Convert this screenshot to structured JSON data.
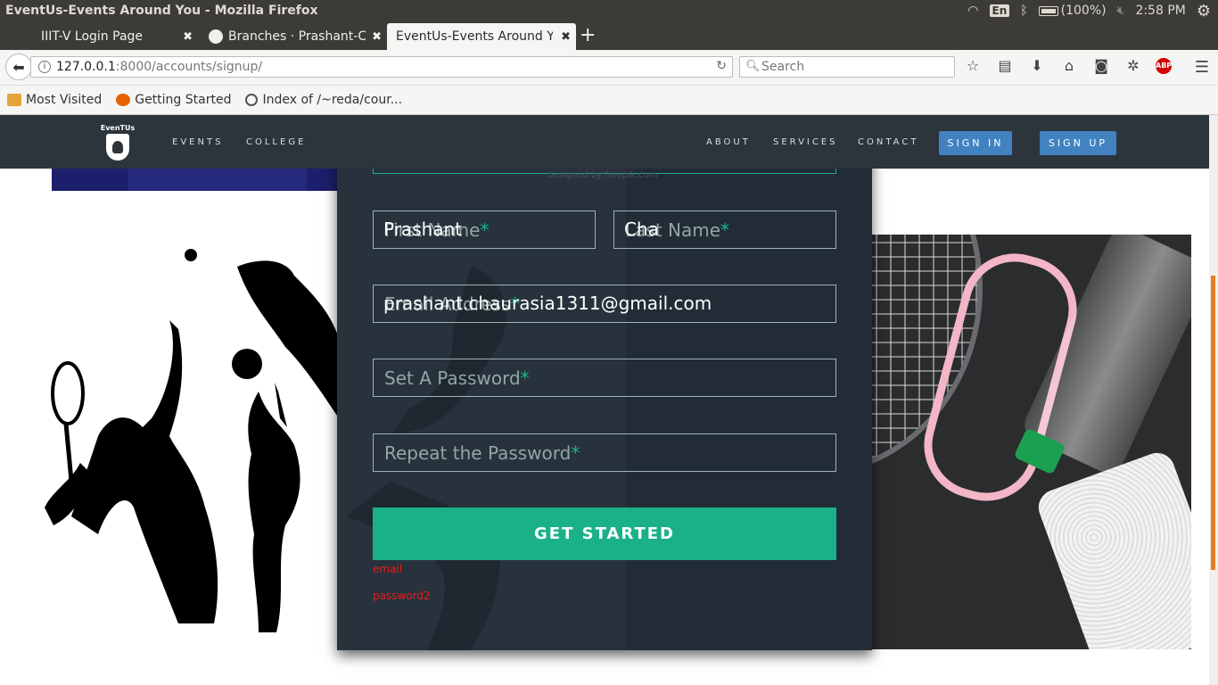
{
  "os": {
    "window_title": "EventUs-Events Around You - Mozilla Firefox",
    "lang": "En",
    "battery": "(100%)",
    "time": "2:58 PM"
  },
  "tabs": [
    {
      "label": "IIIT-V Login Page",
      "close": "✖"
    },
    {
      "label": "Branches · Prashant-Cl",
      "close": "✖"
    },
    {
      "label": "EventUs-Events Around Y",
      "close": "✖"
    }
  ],
  "new_tab": "+",
  "navbar": {
    "url_host": "127.0.0.1",
    "url_path": ":8000/accounts/signup/",
    "search_placeholder": "Search"
  },
  "bookmarks": [
    {
      "label": "Most Visited"
    },
    {
      "label": "Getting Started"
    },
    {
      "label": "Index of /~reda/cour..."
    }
  ],
  "site": {
    "logo_text": "EvenTUs",
    "nav_left": [
      "EVENTS",
      "COLLEGE"
    ],
    "nav_right": [
      "ABOUT",
      "SERVICES",
      "CONTACT"
    ],
    "signin": "SIGN IN",
    "signup": "SIGN UP"
  },
  "form": {
    "designed_by": "designed by freepik.com",
    "first_name": {
      "placeholder": "First Name",
      "value": "Prashant"
    },
    "last_name": {
      "placeholder": "Last Name",
      "value": "Cha"
    },
    "email": {
      "placeholder": "Email Address",
      "value": "prashant.chaurasia1311@gmail.com"
    },
    "password": {
      "placeholder": "Set A Password",
      "value": ""
    },
    "password2": {
      "placeholder": "Repeat the Password",
      "value": ""
    },
    "required_mark": "*",
    "submit": "GET STARTED",
    "errors": [
      "email",
      "password2"
    ]
  },
  "colors": {
    "nav_bg": "#2c343c",
    "card_bg": "#27323c",
    "accent": "#1ab188",
    "button_blue": "#4182c0",
    "error": "#e01f1f"
  }
}
